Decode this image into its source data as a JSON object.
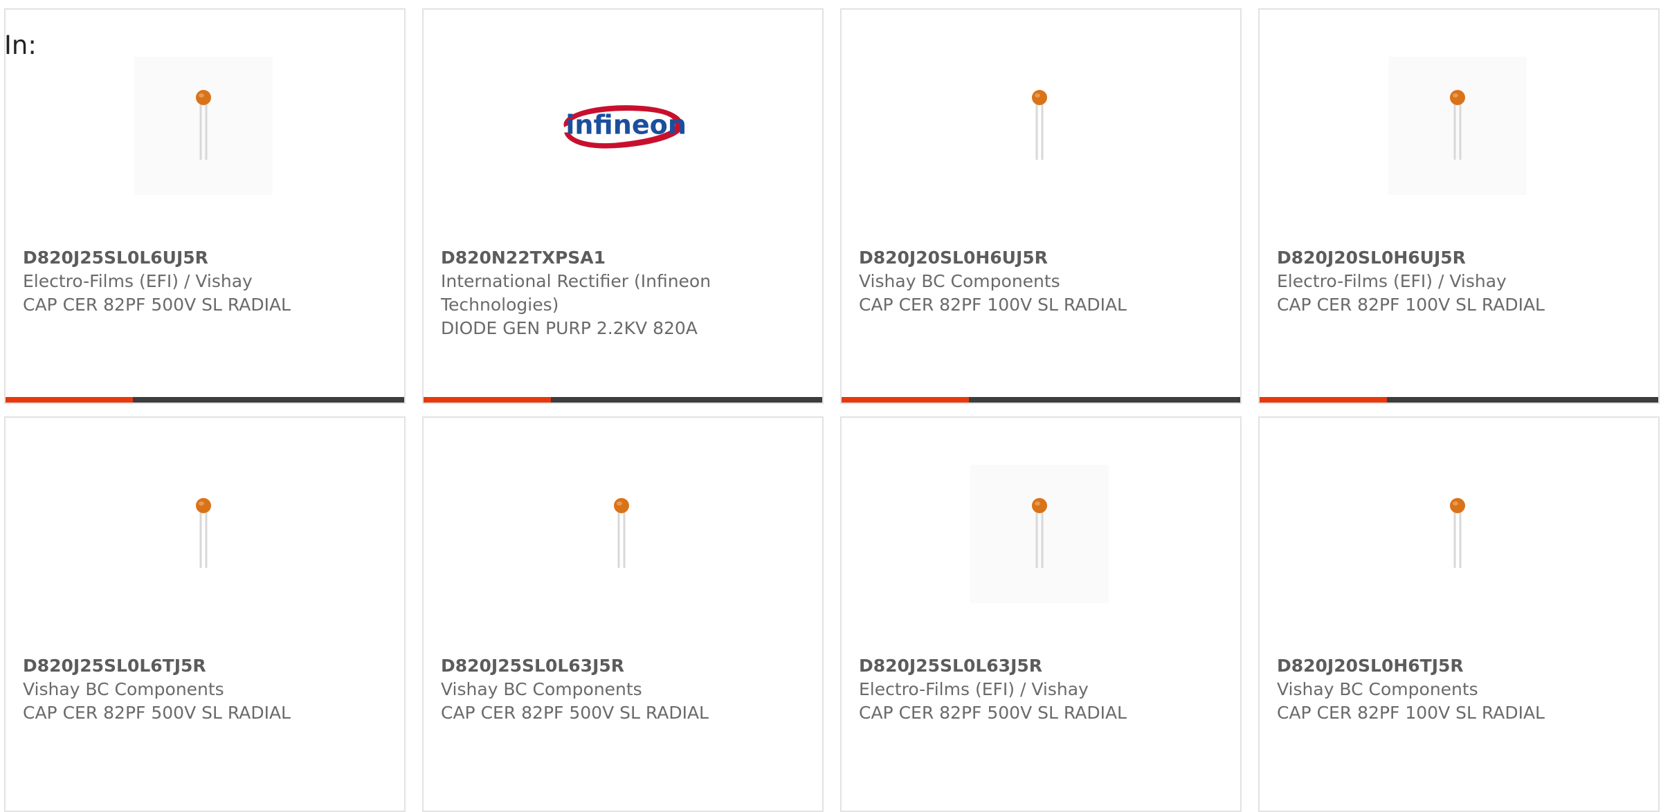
{
  "filter_label": "In:",
  "colors": {
    "accent": "#e8380d",
    "bar_track": "#3d3d3d",
    "capacitor_body": "#d9731a"
  },
  "cards": [
    {
      "part": "D820J25SL0L6UJ5R",
      "manufacturer": "Electro-Films (EFI) / Vishay",
      "description": "CAP CER 82PF 500V SL RADIAL",
      "image": "ceramic-capacitor",
      "progress": 0.32
    },
    {
      "part": "D820N22TXPSA1",
      "manufacturer": "International Rectifier (Infineon Technologies)",
      "description": "DIODE GEN PURP 2.2KV 820A",
      "image": "infineon-logo",
      "logo_text": "infineon",
      "progress": 0.32
    },
    {
      "part": "D820J20SL0H6UJ5R",
      "manufacturer": "Vishay BC Components",
      "description": "CAP CER 82PF 100V SL RADIAL",
      "image": "ceramic-capacitor",
      "progress": 0.32
    },
    {
      "part": "D820J20SL0H6UJ5R",
      "manufacturer": "Electro-Films (EFI) / Vishay",
      "description": "CAP CER 82PF 100V SL RADIAL",
      "image": "ceramic-capacitor",
      "progress": 0.32
    },
    {
      "part": "D820J25SL0L6TJ5R",
      "manufacturer": "Vishay BC Components",
      "description": "CAP CER 82PF 500V SL RADIAL",
      "image": "ceramic-capacitor"
    },
    {
      "part": "D820J25SL0L63J5R",
      "manufacturer": "Vishay BC Components",
      "description": "CAP CER 82PF 500V SL RADIAL",
      "image": "ceramic-capacitor"
    },
    {
      "part": "D820J25SL0L63J5R",
      "manufacturer": "Electro-Films (EFI) / Vishay",
      "description": "CAP CER 82PF 500V SL RADIAL",
      "image": "ceramic-capacitor"
    },
    {
      "part": "D820J20SL0H6TJ5R",
      "manufacturer": "Vishay BC Components",
      "description": "CAP CER 82PF 100V SL RADIAL",
      "image": "ceramic-capacitor"
    }
  ]
}
